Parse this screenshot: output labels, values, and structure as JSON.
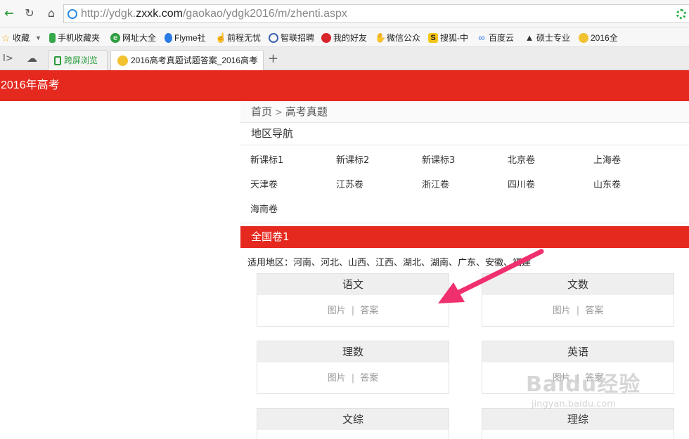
{
  "browser": {
    "url_prefix": "http://ydgk.",
    "url_domain": "zxxk.com",
    "url_path": "/gaokao/ydgk2016/m/zhenti.aspx",
    "bookmarks": [
      {
        "label": "收藏",
        "icon": "star-icon",
        "color": "#f2b01e"
      },
      {
        "label": "手机收藏夹",
        "icon": "phone-icon",
        "color": "#36a84a"
      },
      {
        "label": "网址大全",
        "icon": "globe-icon",
        "color": "#2f9e3f"
      },
      {
        "label": "Flyme社",
        "icon": "flyme-icon",
        "color": "#2b7be5"
      },
      {
        "label": "前程无忧",
        "icon": "hand-icon",
        "color": "#777777"
      },
      {
        "label": "智联招聘",
        "icon": "zhaopin-icon",
        "color": "#3d62b3"
      },
      {
        "label": "我的好友",
        "icon": "weibo-icon",
        "color": "#d7262b"
      },
      {
        "label": "微信公众",
        "icon": "hand-icon",
        "color": "#f2b01e"
      },
      {
        "label": "搜狐-中",
        "icon": "sohu-icon",
        "color": "#f5c518"
      },
      {
        "label": "百度云",
        "icon": "cloud-icon",
        "color": "#2b7be5"
      },
      {
        "label": "硕士专业",
        "icon": "graduation-cap-icon",
        "color": "#333333"
      },
      {
        "label": "2016全",
        "icon": "face-icon",
        "color": "#f2c230"
      }
    ],
    "tabs": [
      {
        "label": "跨屏浏览"
      },
      {
        "label": "2016高考真题试题答案_2016高考"
      }
    ],
    "new_tab": "+"
  },
  "page": {
    "header_title": "2016年高考",
    "breadcrumb": {
      "home": "首页",
      "sep": ">",
      "current": "高考真题"
    },
    "region_nav_title": "地区导航",
    "regions": [
      "新课标1",
      "新课标2",
      "新课标3",
      "北京卷",
      "上海卷",
      "天津卷",
      "江苏卷",
      "浙江卷",
      "四川卷",
      "山东卷",
      "海南卷"
    ],
    "section_title": "全国卷1",
    "applicable_regions": "适用地区：河南、河北、山西、江西、湖北、湖南、广东、安徽、福建",
    "subjects": [
      {
        "name": "语文",
        "image_link": "图片",
        "answer_link": "答案"
      },
      {
        "name": "文数",
        "image_link": "图片",
        "answer_link": "答案"
      },
      {
        "name": "理数",
        "image_link": "图片",
        "answer_link": "答案"
      },
      {
        "name": "英语",
        "image_link": "图片",
        "answer_link": "答案"
      },
      {
        "name": "文综",
        "image_link": "",
        "answer_link": ""
      },
      {
        "name": "理综",
        "image_link": "",
        "answer_link": ""
      }
    ],
    "link_separator": "|"
  },
  "watermark": {
    "logo": "Baidu经验",
    "url": "jingyan.baidu.com"
  },
  "colors": {
    "accent_red": "#e5291f",
    "annotation_arrow": "#f0306e"
  }
}
